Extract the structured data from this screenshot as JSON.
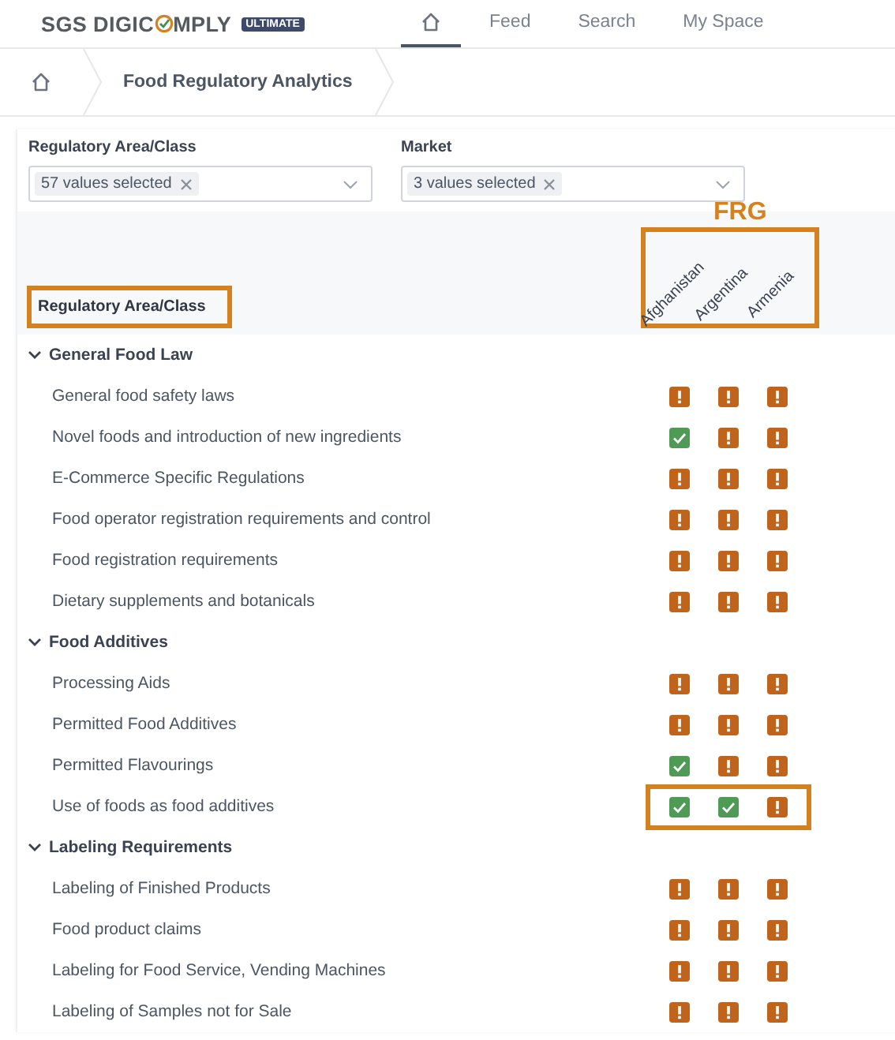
{
  "nav": {
    "logo": {
      "before": "SGS DIGIC",
      "after": "MPLY",
      "badge": "ULTIMATE"
    },
    "tabs": [
      {
        "kind": "home",
        "selected": true
      },
      {
        "kind": "text",
        "label": "Feed",
        "selected": false
      },
      {
        "kind": "text",
        "label": "Search",
        "selected": false
      },
      {
        "kind": "text",
        "label": "My Space",
        "selected": false
      }
    ]
  },
  "breadcrumb": {
    "items": [
      "Food Regulatory Analytics"
    ]
  },
  "filters": [
    {
      "label": "Regulatory Area/Class",
      "chip": "57 values selected"
    },
    {
      "label": "Market",
      "chip": "3 values selected"
    }
  ],
  "matrix": {
    "header": "Regulatory Area/Class",
    "header_highlighted": true,
    "market_annotation": "FRG",
    "markets_highlighted": true,
    "markets": [
      "Afghanistan",
      "Argentina",
      "Armenia"
    ],
    "groups": [
      {
        "name": "General Food Law",
        "expanded": true,
        "children": [
          {
            "name": "General food safety laws",
            "statuses": [
              {
                "compliant": false
              },
              {
                "compliant": false
              },
              {
                "compliant": false
              }
            ],
            "highlighted": false
          },
          {
            "name": "Novel foods and introduction of new ingredients",
            "statuses": [
              {
                "compliant": true
              },
              {
                "compliant": false
              },
              {
                "compliant": false
              }
            ],
            "highlighted": false
          },
          {
            "name": "E-Commerce Specific Regulations",
            "statuses": [
              {
                "compliant": false
              },
              {
                "compliant": false
              },
              {
                "compliant": false
              }
            ],
            "highlighted": false
          },
          {
            "name": "Food operator registration requirements and control",
            "statuses": [
              {
                "compliant": false
              },
              {
                "compliant": false
              },
              {
                "compliant": false
              }
            ],
            "highlighted": false
          },
          {
            "name": "Food registration requirements",
            "statuses": [
              {
                "compliant": false
              },
              {
                "compliant": false
              },
              {
                "compliant": false
              }
            ],
            "highlighted": false
          },
          {
            "name": "Dietary supplements and botanicals",
            "statuses": [
              {
                "compliant": false
              },
              {
                "compliant": false
              },
              {
                "compliant": false
              }
            ],
            "highlighted": false
          }
        ]
      },
      {
        "name": "Food Additives",
        "expanded": true,
        "children": [
          {
            "name": "Processing Aids",
            "statuses": [
              {
                "compliant": false
              },
              {
                "compliant": false
              },
              {
                "compliant": false
              }
            ],
            "highlighted": false
          },
          {
            "name": "Permitted Food Additives",
            "statuses": [
              {
                "compliant": false
              },
              {
                "compliant": false
              },
              {
                "compliant": false
              }
            ],
            "highlighted": false
          },
          {
            "name": "Permitted Flavourings",
            "statuses": [
              {
                "compliant": true
              },
              {
                "compliant": false
              },
              {
                "compliant": false
              }
            ],
            "highlighted": false
          },
          {
            "name": "Use of foods as food additives",
            "statuses": [
              {
                "compliant": true
              },
              {
                "compliant": true
              },
              {
                "compliant": false
              }
            ],
            "highlighted": true
          }
        ]
      },
      {
        "name": "Labeling Requirements",
        "expanded": true,
        "children": [
          {
            "name": "Labeling of Finished Products",
            "statuses": [
              {
                "compliant": false
              },
              {
                "compliant": false
              },
              {
                "compliant": false
              }
            ],
            "highlighted": false
          },
          {
            "name": "Food product claims",
            "statuses": [
              {
                "compliant": false
              },
              {
                "compliant": false
              },
              {
                "compliant": false
              }
            ],
            "highlighted": false
          },
          {
            "name": "Labeling for Food Service, Vending Machines",
            "statuses": [
              {
                "compliant": false
              },
              {
                "compliant": false
              },
              {
                "compliant": false
              }
            ],
            "highlighted": false
          },
          {
            "name": "Labeling of Samples not for Sale",
            "statuses": [
              {
                "compliant": false
              },
              {
                "compliant": false
              },
              {
                "compliant": false
              }
            ],
            "highlighted": false
          }
        ]
      }
    ]
  }
}
